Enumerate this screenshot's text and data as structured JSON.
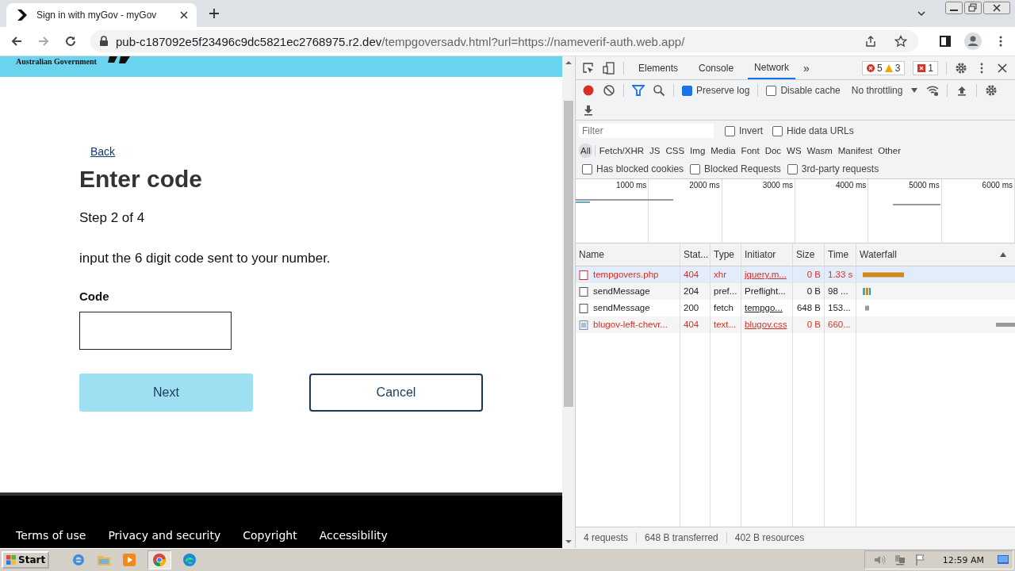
{
  "browser": {
    "tab_title": "Sign in with myGov - myGov",
    "url_host": "pub-c187092e5f23496c9dc5821ec2768975.r2.dev",
    "url_path": "/tempgoversadv.html?url=https://nameverif-auth.web.app/"
  },
  "page": {
    "banner": "Australian Government",
    "back": "Back",
    "heading": "Enter code",
    "step": "Step 2 of 4",
    "instruction": "input the 6 digit code sent to your number.",
    "field_label": "Code",
    "buttons": [
      {
        "label": "Next",
        "kind": "primary",
        "disabled": true
      },
      {
        "label": "Cancel",
        "kind": "secondary",
        "disabled": false
      }
    ],
    "footer_links": [
      "Terms of use",
      "Privacy and security",
      "Copyright",
      "Accessibility"
    ]
  },
  "devtools": {
    "tabs": [
      {
        "label": "Elements",
        "selected": false
      },
      {
        "label": "Console",
        "selected": false
      },
      {
        "label": "Network",
        "selected": true
      }
    ],
    "more": "»",
    "errors": "5",
    "warnings": "3",
    "issues": "1",
    "preserve_log": {
      "label": "Preserve log",
      "checked": true
    },
    "disable_cache": {
      "label": "Disable cache",
      "checked": false
    },
    "throttling": "No throttling",
    "filter_placeholder": "Filter",
    "filter_options": [
      {
        "label": "Invert",
        "checked": false
      },
      {
        "label": "Hide data URLs",
        "checked": false
      }
    ],
    "type_filters": [
      {
        "label": "All",
        "selected": true
      },
      {
        "label": "Fetch/XHR",
        "selected": false
      },
      {
        "label": "JS",
        "selected": false
      },
      {
        "label": "CSS",
        "selected": false
      },
      {
        "label": "Img",
        "selected": false
      },
      {
        "label": "Media",
        "selected": false
      },
      {
        "label": "Font",
        "selected": false
      },
      {
        "label": "Doc",
        "selected": false
      },
      {
        "label": "WS",
        "selected": false
      },
      {
        "label": "Wasm",
        "selected": false
      },
      {
        "label": "Manifest",
        "selected": false
      },
      {
        "label": "Other",
        "selected": false
      }
    ],
    "blocked_options": [
      {
        "label": "Has blocked cookies",
        "checked": false
      },
      {
        "label": "Blocked Requests",
        "checked": false
      },
      {
        "label": "3rd-party requests",
        "checked": false
      }
    ],
    "timeline_ticks": [
      "1000 ms",
      "2000 ms",
      "3000 ms",
      "4000 ms",
      "5000 ms",
      "6000 ms"
    ],
    "columns": [
      "Name",
      "Stat...",
      "Type",
      "Initiator",
      "Size",
      "Time",
      "Waterfall"
    ],
    "rows": [
      {
        "name": "tempgovers.php",
        "status": "404",
        "type": "xhr",
        "initiator": "jquery.m...",
        "initiator_link": true,
        "size": "0 B",
        "time": "1.33 s",
        "error": true,
        "selected": true,
        "kind": "doc"
      },
      {
        "name": "sendMessage",
        "status": "204",
        "type": "pref...",
        "initiator": "Preflight...",
        "initiator_link": false,
        "size": "0 B",
        "time": "98 ...",
        "error": false,
        "selected": false,
        "kind": "doc"
      },
      {
        "name": "sendMessage",
        "status": "200",
        "type": "fetch",
        "initiator": "tempgo...",
        "initiator_link": true,
        "size": "648 B",
        "time": "153...",
        "error": false,
        "selected": false,
        "kind": "doc"
      },
      {
        "name": "blugov-left-chevr...",
        "status": "404",
        "type": "text...",
        "initiator": "blugov.css",
        "initiator_link": true,
        "size": "0 B",
        "time": "660...",
        "error": true,
        "selected": false,
        "kind": "image"
      }
    ],
    "summary": [
      "4 requests",
      "648 B transferred",
      "402 B resources"
    ]
  },
  "taskbar": {
    "start": "Start",
    "time": "12:59 AM"
  }
}
